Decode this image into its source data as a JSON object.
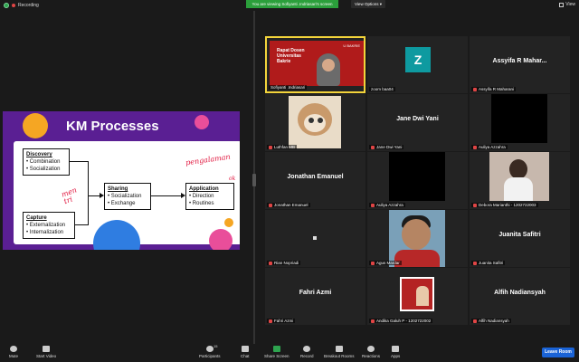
{
  "topbar": {
    "recording": "Recording",
    "banner": "You are viewing Sofiyanti .Indriasari's screen",
    "view_options": "View Options ▾",
    "view": "View"
  },
  "slide": {
    "title": "KM Processes",
    "discovery": {
      "heading": "Discovery",
      "items": [
        "Combination",
        "Socialization"
      ]
    },
    "capture": {
      "heading": "Capture",
      "items": [
        "Externalization",
        "Internalization"
      ]
    },
    "sharing": {
      "heading": "Sharing",
      "items": [
        "Socialization",
        "Exchange"
      ]
    },
    "application": {
      "heading": "Application",
      "items": [
        "Direction",
        "Routines"
      ]
    },
    "annotation_pengalaman": "pengalaman",
    "annotation_mentri": "men tri",
    "annotation_ok": "ok"
  },
  "gallery": [
    {
      "name": "Sofiyanti .Indriasari",
      "overlay": "",
      "video_title": "Rapat Dosen Universitas Bakrie",
      "logo": "U BAKRIE"
    },
    {
      "name": "zoom baa04",
      "overlay": "",
      "avatar": "Z"
    },
    {
      "name": "Assyifa R Maharani",
      "overlay": "Assyifa R Mahar..."
    },
    {
      "name": "Luthfan MB",
      "overlay": ""
    },
    {
      "name": "Jane Dwi Yani",
      "overlay": "Jane Dwi Yani"
    },
    {
      "name": "Auliya Azzahra",
      "overlay": ""
    },
    {
      "name": "Jonathan Emanuel",
      "overlay": "Jonathan Emanuel"
    },
    {
      "name": "Auliya Azzahra",
      "overlay": ""
    },
    {
      "name": "Debora Marianthi - 1202722003",
      "overlay": ""
    },
    {
      "name": "Rian Nopriadi",
      "overlay": ""
    },
    {
      "name": "Agus Mardar",
      "overlay": ""
    },
    {
      "name": "Juanita Safitri",
      "overlay": "Juanita Safitri"
    },
    {
      "name": "Fahri Azmi",
      "overlay": "Fahri Azmi"
    },
    {
      "name": "Andika Galuh P - 1202722002",
      "overlay": ""
    },
    {
      "name": "Alfih Nadiansyah",
      "overlay": "Alfih Nadiansyah"
    }
  ],
  "toolbar": {
    "mute": "Mute",
    "start_video": "Start Video",
    "participants": "Participants",
    "participants_count": "15",
    "chat": "Chat",
    "share_screen": "Share Screen",
    "record": "Record",
    "breakout": "Breakout Rooms",
    "reactions": "Reactions",
    "apps": "Apps",
    "leave": "Leave Room"
  },
  "colors": {
    "accent": "#2ea44f",
    "leave": "#1a63d6",
    "slide_bg": "#5a1f93",
    "active_speaker": "#f3d43b"
  }
}
